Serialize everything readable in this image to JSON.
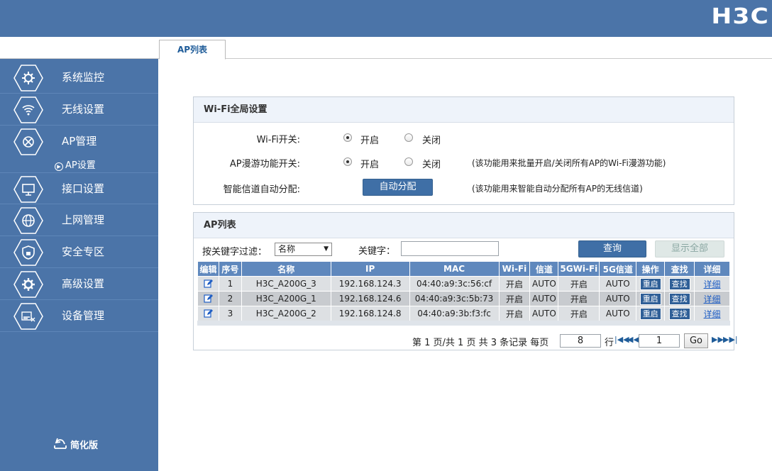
{
  "brand": {
    "logo": "H3C"
  },
  "tabs": [
    {
      "label": "AP列表"
    }
  ],
  "sidebar": {
    "items": [
      {
        "label": "系统监控",
        "icon": "monitor-gear-icon"
      },
      {
        "label": "无线设置",
        "icon": "wifi-icon"
      },
      {
        "label": "AP管理",
        "icon": "ap-icon"
      },
      {
        "label": "接口设置",
        "icon": "interface-icon"
      },
      {
        "label": "上网管理",
        "icon": "globe-icon"
      },
      {
        "label": "安全专区",
        "icon": "shield-lock-icon"
      },
      {
        "label": "高级设置",
        "icon": "gear-icon"
      },
      {
        "label": "设备管理",
        "icon": "device-icon"
      }
    ],
    "sub_item": {
      "label": "AP设置"
    },
    "simplify": "简化版"
  },
  "wifi_global": {
    "title": "Wi-Fi全局设置",
    "wifi_switch": {
      "label": "Wi-Fi开关:",
      "on": "开启",
      "off": "关闭",
      "selected": "on"
    },
    "roam_switch": {
      "label": "AP漫游功能开关:",
      "on": "开启",
      "off": "关闭",
      "selected": "on",
      "note": "(该功能用来批量开启/关闭所有AP的Wi-Fi漫游功能)"
    },
    "channel": {
      "label": "智能信道自动分配:",
      "button": "自动分配",
      "note": "(该功能用来智能自动分配所有AP的无线信道)"
    }
  },
  "ap_list": {
    "title": "AP列表",
    "filter_label": "按关键字过滤：",
    "filter_value": "名称",
    "keyword_label": "关键字：",
    "keyword_value": "",
    "query_button": "查询",
    "show_all_button": "显示全部",
    "columns": [
      "编辑",
      "序号",
      "名称",
      "IP",
      "MAC",
      "Wi-Fi",
      "信道",
      "5GWi-Fi",
      "5G信道",
      "操作",
      "查找",
      "详细"
    ],
    "rows": [
      {
        "no": "1",
        "name": "H3C_A200G_3",
        "ip": "192.168.124.3",
        "mac": "04:40:a9:3c:56:cf",
        "wifi": "开启",
        "channel": "AUTO",
        "wifi5g": "开启",
        "channel5g": "AUTO",
        "op": "重启",
        "find": "查找",
        "detail": "详细"
      },
      {
        "no": "2",
        "name": "H3C_A200G_1",
        "ip": "192.168.124.6",
        "mac": "04:40:a9:3c:5b:73",
        "wifi": "开启",
        "channel": "AUTO",
        "wifi5g": "开启",
        "channel5g": "AUTO",
        "op": "重启",
        "find": "查找",
        "detail": "详细"
      },
      {
        "no": "3",
        "name": "H3C_A200G_2",
        "ip": "192.168.124.8",
        "mac": "04:40:a9:3b:f3:fc",
        "wifi": "开启",
        "channel": "AUTO",
        "wifi5g": "开启",
        "channel5g": "AUTO",
        "op": "重启",
        "find": "查找",
        "detail": "详细"
      }
    ],
    "pager": {
      "summary": "第 1 页/共 1 页 共 3 条记录 每页",
      "per_page": "8",
      "rows_unit": "行",
      "page_input": "1",
      "go": "Go"
    }
  },
  "colors": {
    "primary": "#4b74a8",
    "table_header": "#5f88bd",
    "button": "#3f6fa6",
    "link": "#1f5ec4"
  }
}
